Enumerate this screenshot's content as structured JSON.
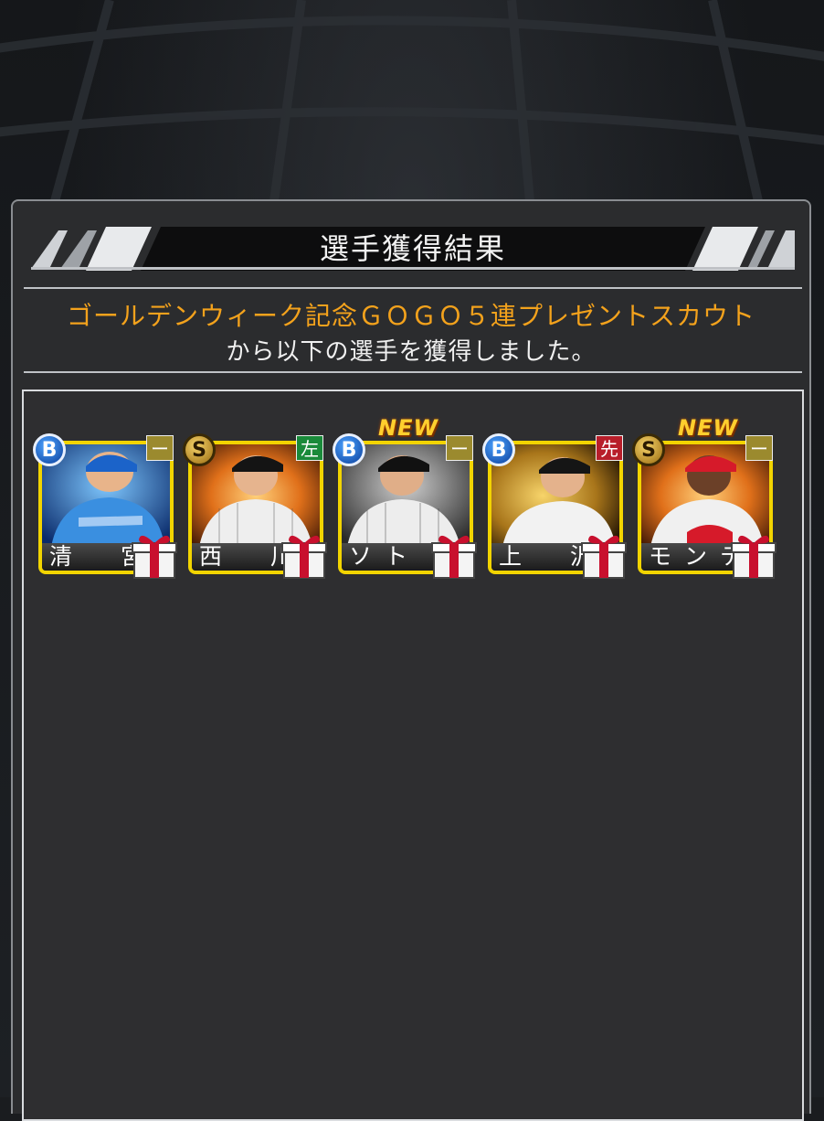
{
  "title": "選手獲得結果",
  "scout_name": "ゴールデンウィーク記念ＧＯＧＯ５連プレゼントスカウト",
  "scout_desc": "から以下の選手を獲得しました。",
  "colors": {
    "scout_name": "#f3a21c",
    "card_border": "#f2d400"
  },
  "players": [
    {
      "name": "清　宮",
      "rank": "B",
      "position": "ー",
      "is_new": false,
      "new_label": "",
      "photo_theme": "blue"
    },
    {
      "name": "西　川",
      "rank": "S",
      "position": "左",
      "is_new": false,
      "new_label": "",
      "photo_theme": "fire"
    },
    {
      "name": "ソト",
      "rank": "B",
      "position": "ー",
      "is_new": true,
      "new_label": "NEW",
      "photo_theme": "gray"
    },
    {
      "name": "上　沢",
      "rank": "B",
      "position": "先",
      "is_new": false,
      "new_label": "",
      "photo_theme": "gold"
    },
    {
      "name": "モンテ",
      "rank": "S",
      "position": "ー",
      "is_new": true,
      "new_label": "NEW",
      "photo_theme": "fire"
    }
  ],
  "icons": {
    "gift": "gift-box-icon"
  }
}
